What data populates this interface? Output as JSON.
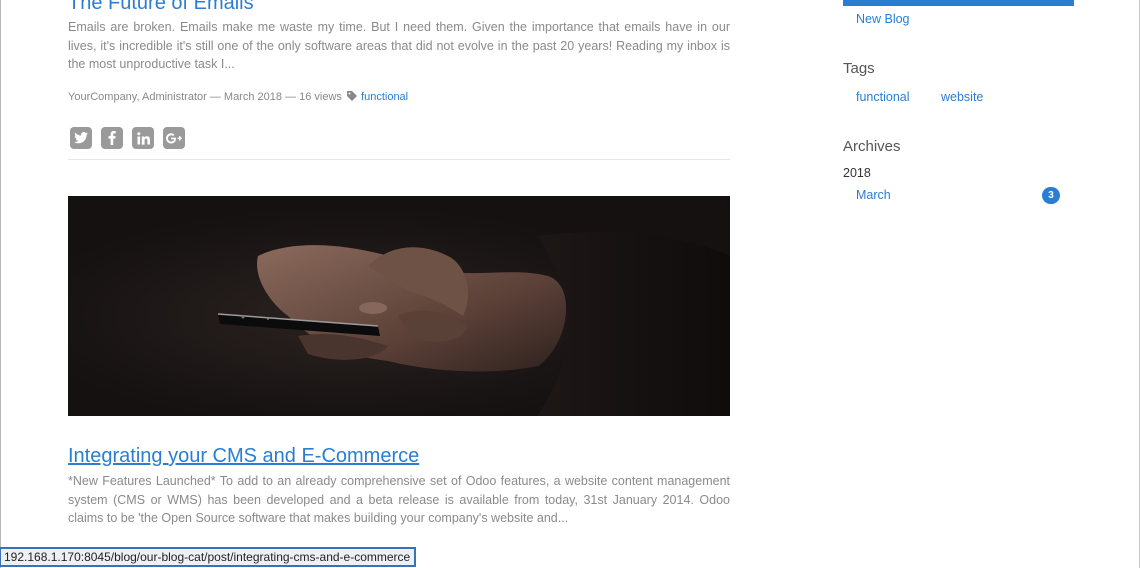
{
  "posts": [
    {
      "title": "The Future of Emails",
      "excerpt": "Emails are broken. Emails make me waste my time. But I need them. Given the importance that emails have in our lives, it's incredible it's still one of the only software areas that did not evolve in the past 20 years! Reading my inbox is the most unproductive task I...",
      "meta": "YourCompany, Administrator — March 2018 — 16 views",
      "tag": "functional",
      "share_icons": [
        "twitter-icon",
        "facebook-icon",
        "linkedin-icon",
        "google-plus-icon"
      ]
    },
    {
      "title": "Integrating your CMS and E-Commerce",
      "excerpt": "*New Features Launched* To add to an already comprehensive set of Odoo features, a website content management system (CMS or WMS) has been developed and a beta release is available from today, 31st January 2014. Odoo claims to be 'the Open Source software that makes building your company's website and..."
    }
  ],
  "sidebar": {
    "blogs": [
      "New Blog"
    ],
    "tags_heading": "Tags",
    "tags": [
      "functional",
      "website"
    ],
    "archives_heading": "Archives",
    "year": "2018",
    "month": "March",
    "month_count": "3"
  },
  "status_url": "192.168.1.170:8045/blog/our-blog-cat/post/integrating-cms-and-e-commerce",
  "colors": {
    "link": "#2a7ed2",
    "text_muted": "#8a8a8a",
    "cover_bg": "#171313"
  }
}
